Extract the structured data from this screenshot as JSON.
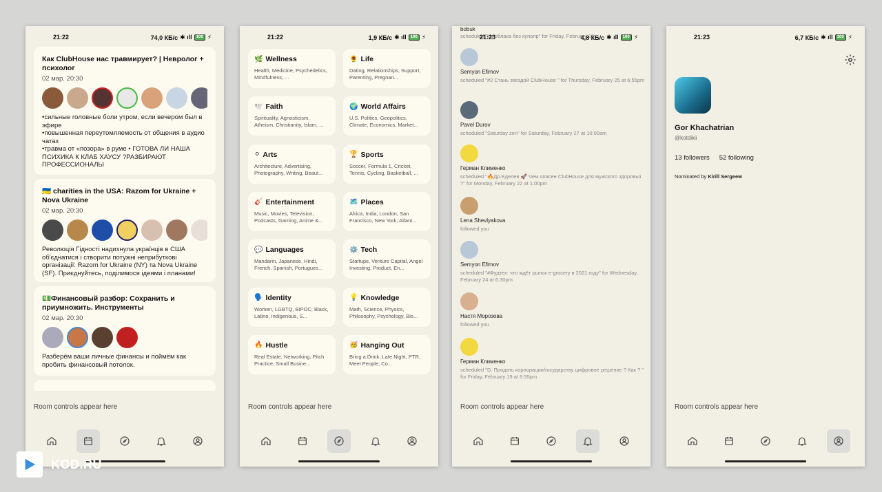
{
  "phones": [
    {
      "time": "21:22",
      "net": "74,0 КБ/с",
      "battery": "100"
    },
    {
      "time": "21:22",
      "net": "1,9 КБ/с",
      "battery": "100"
    },
    {
      "time": "21:23",
      "net": "4,8 КБ/с",
      "battery": "100"
    },
    {
      "time": "21:23",
      "net": "6,7 КБ/с",
      "battery": "100"
    }
  ],
  "room_controls": "Room controls appear here",
  "rooms": [
    {
      "title": "Как ClubHouse нас травмирует? | Невролог + психолог",
      "date": "02 мар. 20:30",
      "text": "•сильные головные боли утром, если вечером был в эфире\n•повышенная переутомляемость от общения в аудио чатах\n•травма от «позора» в руме • ГОТОВА ЛИ НАША ПСИХИКА К КЛАБ ХАУСУ ?РАЗБИРАЮТ ПРОФЕССИОНАЛЫ"
    },
    {
      "title": "🇺🇦 charities in the USA: Razom for Ukraine + Nova Ukraine",
      "date": "02 мар. 20:30",
      "text": "Революція Гідності надихнула українців в США об'єднатися і створити потужні неприбуткові організації: Razom for Ukraine (NY) та Nova Ukraine (SF). Приєднуйтесь, поділимося ідеями і планами!"
    },
    {
      "title": "💵Финансовый разбор: Сохранить и приумножить. Инструменты",
      "date": "02 мар. 20:30",
      "text": "Разберём ваши личные финансы и поймём как пробить финансовый потолок."
    }
  ],
  "topics": [
    {
      "icon": "🌿",
      "name": "Wellness",
      "sub": "Health, Medicine, Psychedelics, Mindfulness, ..."
    },
    {
      "icon": "🌻",
      "name": "Life",
      "sub": "Dating, Relationships, Support, Parenting, Pregnan..."
    },
    {
      "icon": "🕊️",
      "name": "Faith",
      "sub": "Spirituality, Agnosticism, Atheism, Christianity, Islam, ..."
    },
    {
      "icon": "🌍",
      "name": "World Affairs",
      "sub": "U.S. Politics, Geopolitics, Climate, Economics, Market..."
    },
    {
      "icon": "⚪",
      "name": "Arts",
      "sub": "Architecture, Advertising, Photography, Writing, Beaut..."
    },
    {
      "icon": "🏆",
      "name": "Sports",
      "sub": "Soccer, Formula 1, Cricket, Tennis, Cycling, Basketball, ..."
    },
    {
      "icon": "🎸",
      "name": "Entertainment",
      "sub": "Music, Movies, Television, Podcasts, Gaming, Anime &..."
    },
    {
      "icon": "🗺️",
      "name": "Places",
      "sub": "Africa, India, London, San Francisco, New York, Atlant..."
    },
    {
      "icon": "💬",
      "name": "Languages",
      "sub": "Mandarin, Japanese, Hindi, French, Spanish, Portugues..."
    },
    {
      "icon": "⚙️",
      "name": "Tech",
      "sub": "Startups, Venture Capital, Angel Investing, Product, En..."
    },
    {
      "icon": "🗣️",
      "name": "Identity",
      "sub": "Women, LGBTQ, BIPOC, Black, Latino, Indigenous, S..."
    },
    {
      "icon": "💡",
      "name": "Knowledge",
      "sub": "Math, Science, Physics, Philosophy, Psychology, Bio..."
    },
    {
      "icon": "🔥",
      "name": "Hustle",
      "sub": "Real Estate, Networking, Pitch Practice, Small Busine..."
    },
    {
      "icon": "🥳",
      "name": "Hanging Out",
      "sub": "Bring a Drink, Late Night, PTR, Meet People, Co..."
    }
  ],
  "notif_top": {
    "name": "bobuk",
    "text": "scheduled \"Из облака без куполр\" for Friday, February 26..."
  },
  "notifications": [
    {
      "name": "Semyon Efimov",
      "text": "scheduled \"#2 Стань звездой ClubHouse \" for Thursday, February 25 at 6:55pm"
    },
    {
      "name": "Pavel Durov",
      "text": "scheduled \"Saturday zen\" for Saturday, February 27 at 10:00am"
    },
    {
      "name": "Герман Клименко",
      "text": "scheduled \"🔥Др.Еделев 🚀 Чем опасен ClubHouse для мужского здоровья ?\" for Monday, February 22 at 1:00pm"
    },
    {
      "name": "Lena Shevlyakova",
      "text": "followed you"
    },
    {
      "name": "Semyon Efimov",
      "text": "scheduled \"#Фудтех: что ждёт рынок e-grocery в 2021 году\" for Wednesday, February 24 at 6:30pm"
    },
    {
      "name": "Настя Морозова",
      "text": "followed you"
    },
    {
      "name": "Герман Клименко",
      "text": "scheduled \"D. Продать корпорации/государству цифровое решение ? Как ? \" for Friday, February 19 at 9:35pm"
    }
  ],
  "profile": {
    "name": "Gor Khachatrian",
    "handle": "@kotdikii",
    "followers": "13 followers",
    "following": "52 following",
    "nominated_prefix": "Nominated by",
    "nominated_by": "Kirill Sergeew"
  },
  "watermark": "KOD.RU",
  "colors": {
    "bg": "#f2efe4",
    "card": "#fdfaf0",
    "active_nav": "#dcdcd8"
  }
}
